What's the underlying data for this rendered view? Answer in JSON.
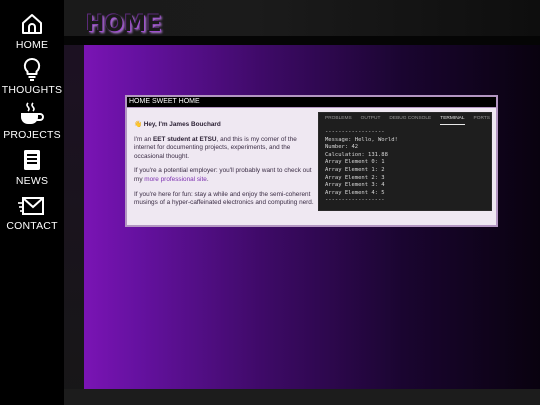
{
  "nav": {
    "items": [
      {
        "label": "HOME",
        "icon": "home-icon"
      },
      {
        "label": "THOUGHTS",
        "icon": "lightbulb-icon"
      },
      {
        "label": "PROJECTS",
        "icon": "coffee-cup-icon"
      },
      {
        "label": "NEWS",
        "icon": "newspaper-icon"
      },
      {
        "label": "CONTACT",
        "icon": "mail-icon"
      }
    ]
  },
  "page": {
    "title": "HOME"
  },
  "window": {
    "title": "HOME SWEET HOME",
    "greeting_emoji": "👋",
    "greeting": "Hey, I'm James Bouchard",
    "para1_pre": "I'm an ",
    "para1_bold": "EET student at ETSU",
    "para1_post": ", and this is my corner of the internet for documenting projects, experiments, and the occasional thought.",
    "para2_pre": "If you're a potential employer: you'll probably want to check out my ",
    "para2_link": "more professional site",
    "para2_post": ".",
    "para3": "If you're here for fun: stay a while and enjoy the semi-coherent musings of a hyper-caffeinated electronics and computing nerd."
  },
  "terminal": {
    "tabs": [
      "PROBLEMS",
      "OUTPUT",
      "DEBUG CONSOLE",
      "TERMINAL",
      "PORTS"
    ],
    "active_tab": "TERMINAL",
    "lines": [
      "------------------",
      "Message: Hello, World!",
      "Number: 42",
      "Calculation: 131.88",
      "Array Element 0: 1",
      "Array Element 1: 2",
      "Array Element 2: 3",
      "Array Element 3: 4",
      "Array Element 4: 5",
      "------------------"
    ]
  },
  "colors": {
    "accent": "#7a14b4",
    "link": "#7c2fb0",
    "window_bg": "#efe8f2",
    "terminal_bg": "#1e1e1e"
  }
}
